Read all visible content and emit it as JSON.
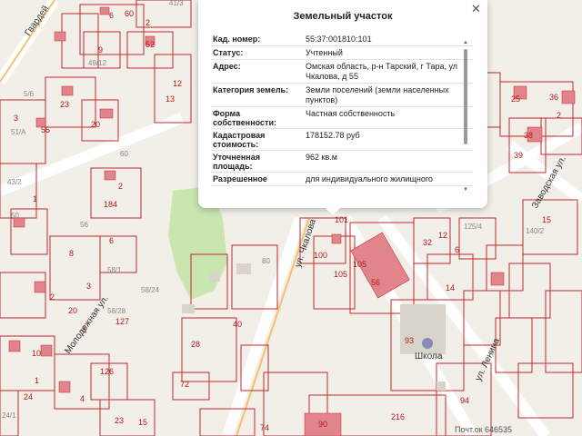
{
  "popup": {
    "title": "Земельный участок",
    "close_icon": "close-icon",
    "rows": [
      {
        "key": "Кад. номер:",
        "value": "55:37:001810:101"
      },
      {
        "key": "Статус:",
        "value": "Учтенный"
      },
      {
        "key": "Адрес:",
        "value": "Омская область, р-н Тарский, г Тара, ул Чкалова, д 55"
      },
      {
        "key": "Категория земель:",
        "value": "Земли поселений (земли населенных пунктов)"
      },
      {
        "key": "Форма собственности:",
        "value": "Частная собственность"
      },
      {
        "key": "Кадастровая стоимость:",
        "value": "178152.78 руб"
      },
      {
        "key": "Уточненная площадь:",
        "value": "962 кв.м"
      },
      {
        "key": "Разрешенное",
        "value": "для индивидуального жилищного"
      }
    ]
  },
  "map": {
    "streets": {
      "gvard": "Гвардей",
      "chkalova": "ул. Чкалова",
      "lenina": "ул. Ленина",
      "zavodskaya": "Заводская ул.",
      "molodezh": "Молодежная ул.",
      "school": "Школа",
      "postcode": "646535"
    },
    "labels": [
      "6",
      "60",
      "41/3",
      "2",
      "29",
      "52",
      "9",
      "49/12",
      "46",
      "12",
      "13",
      "23",
      "20",
      "3",
      "55",
      "51/А",
      "5/6",
      "1",
      "2",
      "184",
      "43/2",
      "56",
      "60",
      "105",
      "100",
      "101",
      "105",
      "56",
      "32",
      "12",
      "6",
      "125/4",
      "15",
      "140/2",
      "25",
      "38",
      "39",
      "36",
      "2",
      "8",
      "58/1",
      "6",
      "58/24",
      "58/28",
      "127",
      "40",
      "80",
      "28",
      "72",
      "126",
      "8",
      "10",
      "20",
      "4",
      "24/1",
      "24",
      "1",
      "23",
      "15",
      "74",
      "90",
      "216",
      "93",
      "94",
      "14",
      "3",
      "2",
      "50"
    ]
  },
  "watermark": "Почт.ок 646535"
}
